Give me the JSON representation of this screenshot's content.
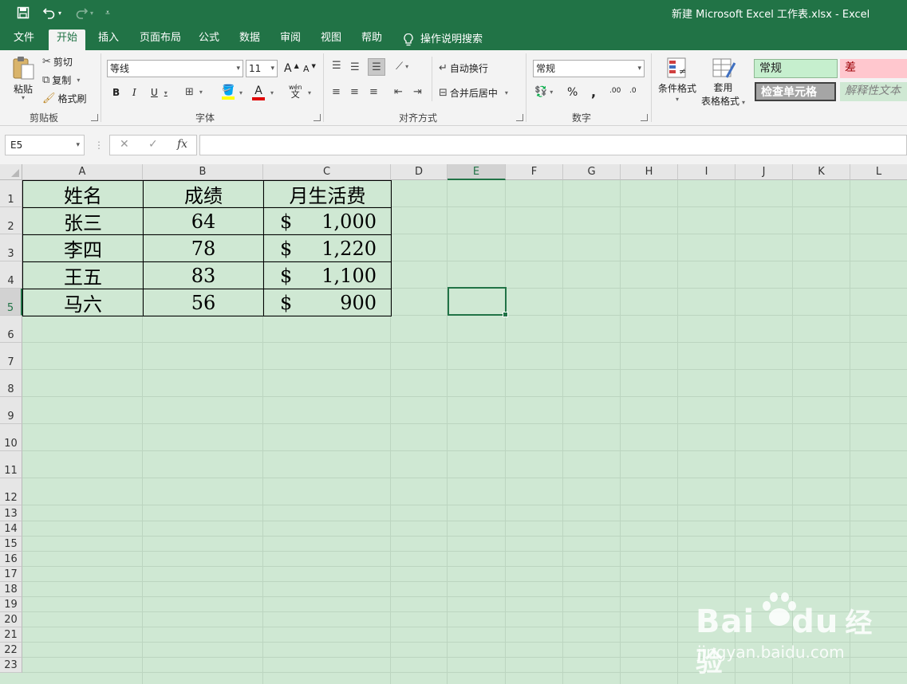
{
  "title_bar": {
    "title": "新建 Microsoft Excel 工作表.xlsx  -  Excel",
    "save_icon": "save-icon",
    "undo_icon": "undo-icon",
    "redo_icon": "redo-icon",
    "customize_icon": "customize-quick-access-icon"
  },
  "tabs": [
    {
      "label": "文件"
    },
    {
      "label": "开始"
    },
    {
      "label": "插入"
    },
    {
      "label": "页面布局"
    },
    {
      "label": "公式"
    },
    {
      "label": "数据"
    },
    {
      "label": "审阅"
    },
    {
      "label": "视图"
    },
    {
      "label": "帮助"
    }
  ],
  "active_tab": "开始",
  "tell_me": {
    "label": "操作说明搜索",
    "icon": "lightbulb-icon"
  },
  "ribbon": {
    "clipboard": {
      "group_label": "剪贴板",
      "paste": "粘贴",
      "cut": "剪切",
      "copy": "复制",
      "format_painter": "格式刷"
    },
    "font": {
      "group_label": "字体",
      "font_name": "等线",
      "font_size": "11",
      "bold": "B",
      "italic": "I",
      "underline": "U",
      "increase_font": "A",
      "decrease_font": "A",
      "font_color_letter": "A",
      "phonetic_top": "wén",
      "phonetic_bottom": "文",
      "fill_color": "#ffff00",
      "font_color": "#e00000"
    },
    "alignment": {
      "group_label": "对齐方式",
      "wrap_text": "自动换行",
      "merge_center": "合并后居中"
    },
    "number": {
      "group_label": "数字",
      "format": "常规",
      "percent": "%",
      "comma": ",",
      "inc_decimal": ".00",
      "dec_decimal": ".0"
    },
    "styles": {
      "conditional_formatting": "条件格式",
      "format_as_table_line1": "套用",
      "format_as_table_line2": "表格格式",
      "normal": "常规",
      "bad": "差",
      "check_cell": "检查单元格",
      "explanatory": "解释性文本"
    }
  },
  "formula_bar": {
    "name_box": "E5",
    "cancel": "✕",
    "enter": "✓",
    "fx": "fx",
    "content": ""
  },
  "columns": [
    "A",
    "B",
    "C",
    "D",
    "E",
    "F",
    "G",
    "H",
    "I",
    "J",
    "K",
    "L"
  ],
  "rows": [
    "1",
    "2",
    "3",
    "4",
    "5",
    "6",
    "7",
    "8",
    "9",
    "10",
    "11",
    "12",
    "13",
    "14",
    "15",
    "16",
    "17",
    "18",
    "19",
    "20",
    "21",
    "22",
    "23"
  ],
  "selected_cell": {
    "column": "E",
    "row": "5"
  },
  "sheet": {
    "headers": [
      "姓名",
      "成绩",
      "月生活费"
    ],
    "rows": [
      {
        "name": "张三",
        "score": "64",
        "currency": "$",
        "amount": "1,000"
      },
      {
        "name": "李四",
        "score": "78",
        "currency": "$",
        "amount": "1,220"
      },
      {
        "name": "王五",
        "score": "83",
        "currency": "$",
        "amount": "1,100"
      },
      {
        "name": "马六",
        "score": "56",
        "currency": "$",
        "amount": "900"
      }
    ]
  },
  "watermark": {
    "brand_latin": "Bai",
    "brand_latin_end": "du",
    "brand_cn": "经验",
    "site": "jingyan.baidu.com"
  },
  "colors": {
    "accent": "#217346",
    "sheet_background": "#cfe8d3",
    "style_normal": "#c6efce",
    "style_bad": "#ffc7ce",
    "style_check": "#a5a5a5"
  }
}
